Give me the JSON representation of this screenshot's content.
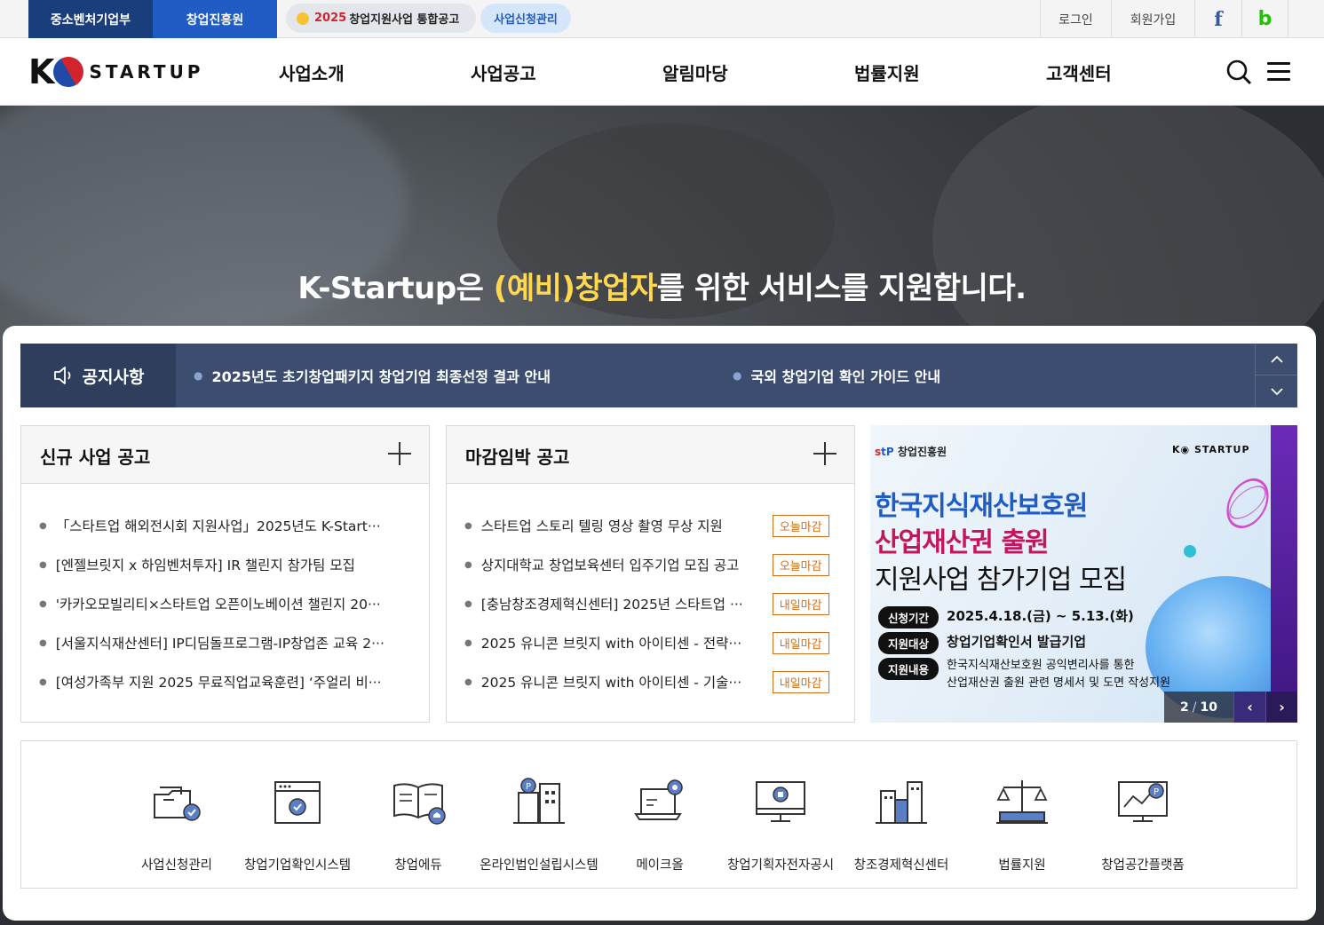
{
  "topbar": {
    "tabs": [
      "중소벤처기업부",
      "창업진흥원"
    ],
    "promo": {
      "year": "2025",
      "text": "창업지원사업 통합공고"
    },
    "apply_link": "사업신청관리",
    "login": "로그인",
    "signup": "회원가입",
    "facebook": "f",
    "blog": "b"
  },
  "header": {
    "logo_k": "K",
    "logo_text": "STARTUP",
    "nav": [
      "사업소개",
      "사업공고",
      "알림마당",
      "법률지원",
      "고객센터"
    ]
  },
  "hero": {
    "text_before": "K-Startup은 ",
    "highlight": "(예비)창업자",
    "text_after": "를 위한 서비스를 지원합니다."
  },
  "notice": {
    "label": "공지사항",
    "items": [
      "2025년도 초기창업패키지 창업기업 최종선정 결과 안내",
      "국외 창업기업 확인 가이드 안내"
    ],
    "up": "˄",
    "down": "˅"
  },
  "new_biz": {
    "title": "신규 사업 공고",
    "items": [
      "「스타트업 해외전시회 지원사업」2025년도 K-Start···",
      "[엔젤브릿지 x 하임벤처투자] IR 챌린지 참가팀 모집",
      "'카카오모빌리티×스타트업 오픈이노베이션 챌린지 20···",
      "[서울지식재산센터] IP디딤돌프로그램-IP창업존 교육 2···",
      "[여성가족부 지원 2025 무료직업교육훈련] ‘주얼리 비···"
    ]
  },
  "deadline": {
    "title": "마감임박 공고",
    "items": [
      {
        "text": "스타트업 스토리 텔링 영상 촬영 무상 지원",
        "badge": "오늘마감"
      },
      {
        "text": "상지대학교 창업보육센터 입주기업 모집 공고",
        "badge": "오늘마감"
      },
      {
        "text": "[충남창조경제혁신센터] 2025년 스타트업 ···",
        "badge": "내일마감"
      },
      {
        "text": "2025 유니콘 브릿지 with 아이티센 - 전략···",
        "badge": "내일마감"
      },
      {
        "text": "2025 유니콘 브릿지 with 아이티센 - 기술···",
        "badge": "내일마감"
      }
    ]
  },
  "banner": {
    "org": "창업진흥원",
    "org_mark_s": "s",
    "org_mark_t": "t",
    "org_mark_p": "P",
    "logo": "STARTUP",
    "line1": "한국지식재산보호원",
    "line2": "산업재산권 출원",
    "line3": "지원사업 참가기업 모집",
    "rows": [
      {
        "label": "신청기간",
        "value": "2025.4.18.(금) ~ 5.13.(화)"
      },
      {
        "label": "지원대상",
        "value": "창업기업확인서 발급기업"
      },
      {
        "label": "지원내용",
        "value": "한국지식재산보호원 공익변리사를 통한",
        "value2": "산업재산권 출원 관련 명세서 및 도면 작성지원"
      }
    ],
    "current": "2",
    "total": "10",
    "prev": "‹",
    "next": "›"
  },
  "quick_links": [
    "사업신청관리",
    "창업기업확인시스템",
    "창업에듀",
    "온라인법인설립시스템",
    "메이크올",
    "창업기획자전자공시",
    "창조경제혁신센터",
    "법률지원",
    "창업공간플랫폼"
  ],
  "colors": {
    "navy": "#1a3d7c",
    "blue": "#1f5cc4",
    "notice_bg": "#3c4d6f",
    "badge": "#d2701e",
    "hero_highlight": "#ffd84d"
  }
}
